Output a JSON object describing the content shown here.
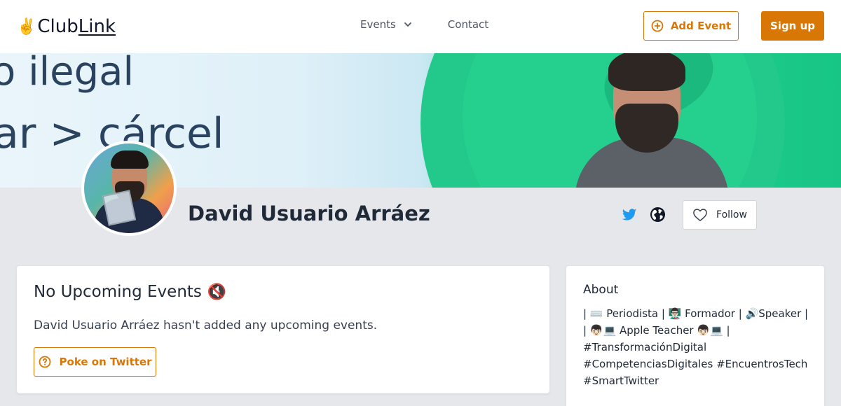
{
  "header": {
    "logo_hand": "✌️",
    "logo_club": "Club",
    "logo_link": "Link",
    "nav": {
      "events": "Events",
      "contact": "Contact"
    },
    "add_event": "Add Event",
    "sign_up": "Sign up"
  },
  "banner": {
    "line1": "o ilegal",
    "line2": "ar > cárcel"
  },
  "profile": {
    "name": "David Usuario Arráez",
    "follow": "Follow",
    "icons": [
      "twitter-icon",
      "globe-icon",
      "heart-icon"
    ]
  },
  "events_card": {
    "title": "No Upcoming Events",
    "title_emoji": "🔇",
    "description": "David Usuario Arráez hasn't added any upcoming events.",
    "poke": "Poke on Twitter"
  },
  "about": {
    "title": "About",
    "text": "| ⌨️ Periodista | 👨🏻‍🏫 Formador | 🔊Speaker | | 👦🏻💻 Apple Teacher 👦🏻💻 | #TransformaciónDigital #CompetenciasDigitales #EncuentrosTech #SmartTwitter"
  },
  "colors": {
    "accent": "#d97706",
    "twitter": "#1d9bf0",
    "page_bg": "#e5e7eb"
  }
}
